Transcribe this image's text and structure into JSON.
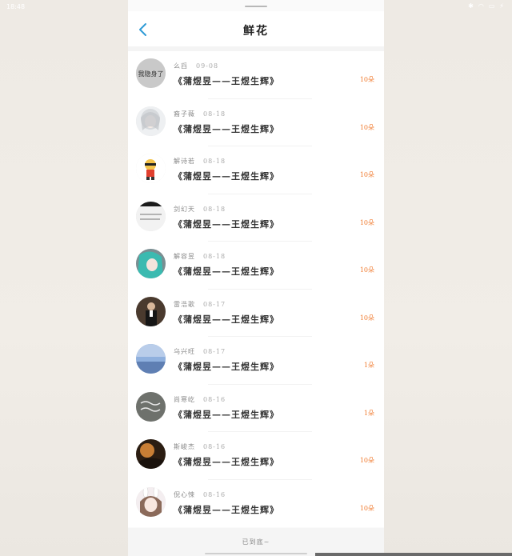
{
  "status_bar": {
    "time": "18:48",
    "icons": [
      "bluetooth-icon",
      "wifi-icon",
      "battery-icon",
      "charging-icon"
    ]
  },
  "header": {
    "title": "鲜花",
    "back_icon": "chevron-left-icon"
  },
  "accent_color": "#2f9bd6",
  "count_color": "#f07a2e",
  "items": [
    {
      "name": "么舀",
      "date": "09-08",
      "book": "《蒲煜昱——王煜生辉》",
      "count": "10朵",
      "avatar": "text-avatar-gray"
    },
    {
      "name": "裔子薇",
      "date": "08-18",
      "book": "《蒲煜昱——王煜生辉》",
      "count": "10朵",
      "avatar": "anime-white-hair"
    },
    {
      "name": "解诗若",
      "date": "08-18",
      "book": "《蒲煜昱——王煜生辉》",
      "count": "10朵",
      "avatar": "cartoon-character"
    },
    {
      "name": "剑幻天",
      "date": "08-18",
      "book": "《蒲煜昱——王煜生辉》",
      "count": "10朵",
      "avatar": "text-note"
    },
    {
      "name": "解容昱",
      "date": "08-18",
      "book": "《蒲煜昱——王煜生辉》",
      "count": "10朵",
      "avatar": "anime-teal-hair"
    },
    {
      "name": "雷浩歌",
      "date": "08-17",
      "book": "《蒲煜昱——王煜生辉》",
      "count": "10朵",
      "avatar": "man-in-suit"
    },
    {
      "name": "乌兴旺",
      "date": "08-17",
      "book": "《蒲煜昱——王煜生辉》",
      "count": "1朵",
      "avatar": "blue-sky"
    },
    {
      "name": "尚寒屹",
      "date": "08-16",
      "book": "《蒲煜昱——王煜生辉》",
      "count": "1朵",
      "avatar": "handwriting-dark"
    },
    {
      "name": "斯峻杰",
      "date": "08-16",
      "book": "《蒲煜昱——王煜生辉》",
      "count": "10朵",
      "avatar": "sunset-photo"
    },
    {
      "name": "倪心悚",
      "date": "08-16",
      "book": "《蒲煜昱——王煜生辉》",
      "count": "10朵",
      "avatar": "anime-bunny-girl"
    }
  ],
  "footer": {
    "text": "已到底~"
  }
}
